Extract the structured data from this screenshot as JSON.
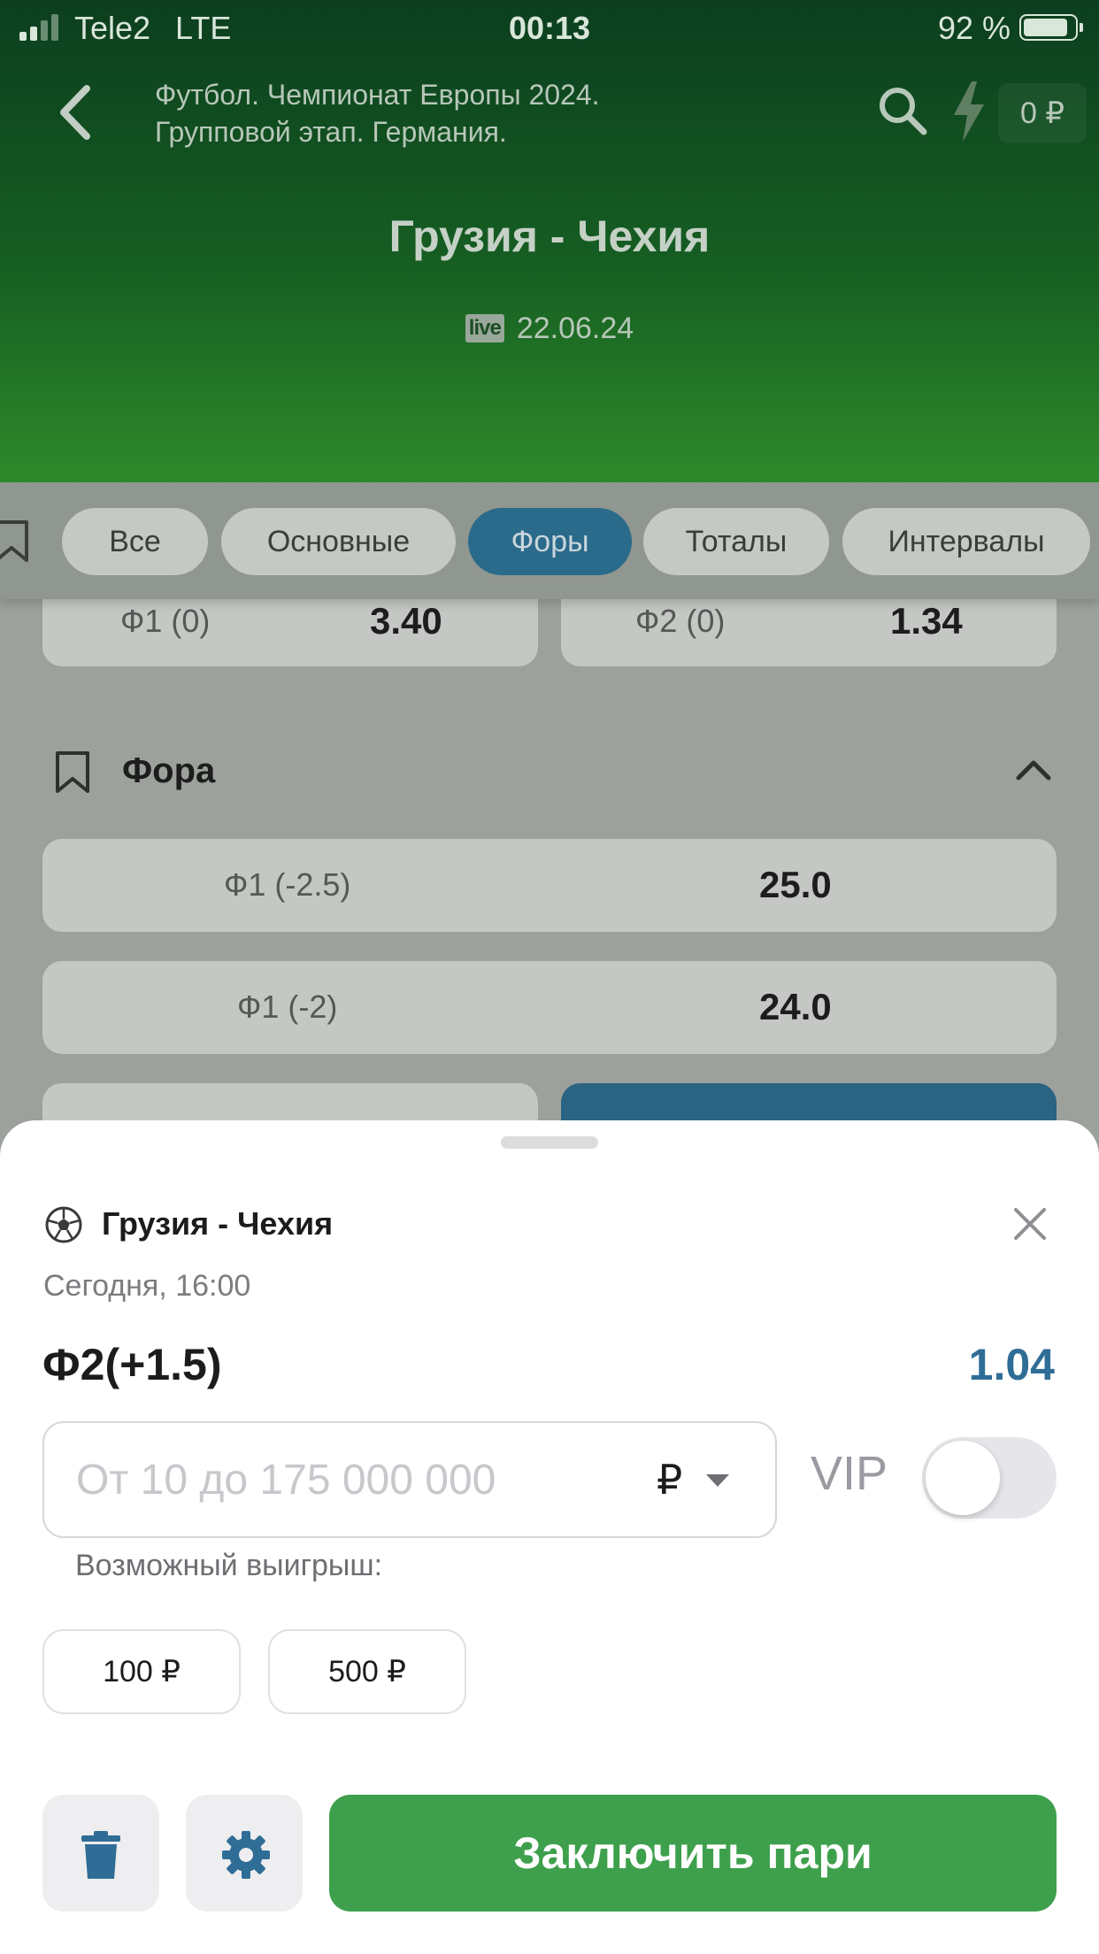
{
  "status_bar": {
    "carrier": "Tele2",
    "network": "LTE",
    "time": "00:13",
    "battery_percent": "92 %",
    "battery_level": 0.92,
    "signal_bars_active": 2
  },
  "header": {
    "tournament_line1": "Футбол. Чемпионат Европы 2024.",
    "tournament_line2": "Групповой этап. Германия.",
    "balance": "0 ₽",
    "match_title": "Грузия - Чехия",
    "live_badge": "live",
    "date": "22.06.24",
    "icons": [
      "back-arrow-icon",
      "search-icon",
      "lightning-icon"
    ]
  },
  "tabs": [
    {
      "label": "Все",
      "active": false
    },
    {
      "label": "Основные",
      "active": false
    },
    {
      "label": "Форы",
      "active": true
    },
    {
      "label": "Тоталы",
      "active": false
    },
    {
      "label": "Интервалы",
      "active": false
    }
  ],
  "markets": {
    "top_row": [
      {
        "label": "Ф1 (0)",
        "odds": "3.40"
      },
      {
        "label": "Ф2 (0)",
        "odds": "1.34"
      }
    ],
    "section_title": "Фора",
    "handicap_rows": [
      {
        "label": "Ф1  (-2.5)",
        "odds": "25.0"
      },
      {
        "label": "Ф1  (-2)",
        "odds": "24.0"
      }
    ]
  },
  "bet_slip": {
    "match": "Грузия - Чехия",
    "time": "Сегодня, 16:00",
    "bet_name": "Ф2(+1.5)",
    "odds": "1.04",
    "amount_placeholder": "От 10 до 175 000 000",
    "amount_value": "",
    "currency": "₽",
    "vip_label": "VIP",
    "vip_enabled": false,
    "possible_win_label": "Возможный выигрыш:",
    "quick_amounts": [
      "100 ₽",
      "500 ₽"
    ],
    "submit_label": "Заключить пари"
  },
  "colors": {
    "header_top": "#0c3e1f",
    "header_bottom": "#2e8a2b",
    "active_tab": "#2a6a8a",
    "odds_accent": "#2f6d96",
    "submit": "#3ea04c",
    "action_icon": "#2f6d96"
  }
}
